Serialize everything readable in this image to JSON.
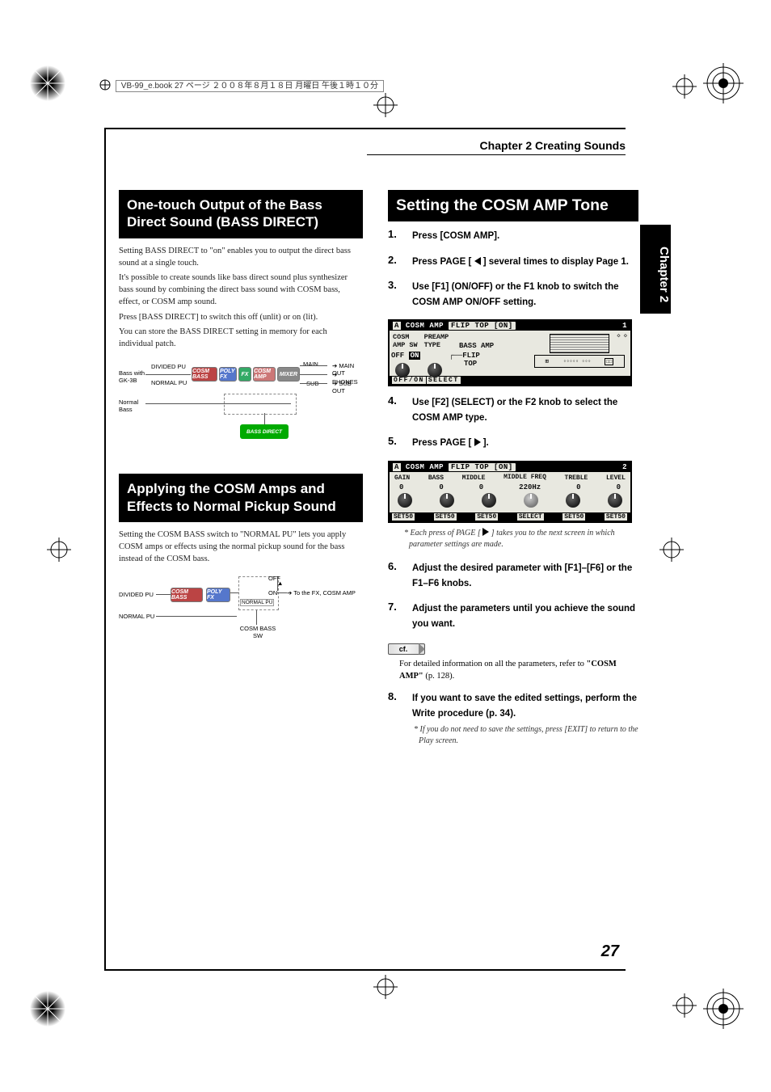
{
  "meta": {
    "header_info": "VB-99_e.book 27 ページ ２００８年８月１８日 月曜日 午後１時１０分"
  },
  "chapter_header": "Chapter 2 Creating Sounds",
  "side_tab": "Chapter 2",
  "page_number": "27",
  "left": {
    "section1": {
      "title": "One-touch Output of the Bass Direct Sound (BASS DIRECT)",
      "p1": "Setting BASS DIRECT to \"on\" enables you to output the direct bass sound at a single touch.",
      "p2": "It's possible to create sounds like bass direct sound plus synthesizer bass sound by combining the direct bass sound with COSM bass, effect, or COSM amp sound.",
      "p3": "Press [BASS DIRECT] to switch this off (unlit) or on (lit).",
      "p4": "You can store the BASS DIRECT setting in memory for each individual patch.",
      "diagram1": {
        "bass_with": "Bass with\nGK-3B",
        "normal_bass": "Normal\nBass",
        "divided_pu": "DIVIDED PU",
        "normal_pu": "NORMAL PU",
        "blk_cosm_bass": "COSM BASS",
        "blk_poly_fx": "POLY FX",
        "blk_fx": "FX",
        "blk_cosm_amp": "COSM AMP",
        "blk_mixer": "MIXER",
        "main": "MAIN",
        "sub": "SUB",
        "main_out": "MAIN OUT",
        "phones": "PHONES",
        "sub_out": "SUB OUT",
        "bass_direct": "BASS DIRECT"
      }
    },
    "section2": {
      "title": "Applying the COSM Amps and Effects to Normal Pickup Sound",
      "p1": "Setting the COSM BASS switch to \"NORMAL PU\" lets you apply COSM amps or effects using the normal pickup sound for the bass instead of the COSM bass.",
      "diagram2": {
        "divided_pu": "DIVIDED PU",
        "normal_pu": "NORMAL PU",
        "cosm_bass": "COSM BASS",
        "poly_fx": "POLY FX",
        "off": "OFF",
        "on": "ON",
        "normal_pu_opt": "NORMAL PU",
        "to_fx": "To the FX, COSM AMP",
        "sw_label": "COSM BASS\nSW"
      }
    }
  },
  "right": {
    "section": {
      "title": "Setting the COSM AMP Tone",
      "steps": [
        {
          "num": "1.",
          "text": "Press [COSM AMP]."
        },
        {
          "num": "2.",
          "text_pre": "Press PAGE [ ",
          "text_post": " ] several times to display Page 1.",
          "tri": "left"
        },
        {
          "num": "3.",
          "text": "Use [F1] (ON/OFF) or the F1 knob to switch the COSM AMP ON/OFF setting."
        },
        {
          "num": "4.",
          "text": "Use [F2] (SELECT) or the F2 knob to select the COSM AMP type."
        },
        {
          "num": "5.",
          "text_pre": "Press PAGE [ ",
          "text_post": " ].",
          "tri": "right",
          "note_pre": "Each press of PAGE [ ",
          "note_post": " ] takes you to the next screen in which parameter settings are made."
        },
        {
          "num": "6.",
          "text": "Adjust the desired parameter with [F1]–[F6] or the F1–F6 knobs."
        },
        {
          "num": "7.",
          "text": "Adjust the parameters until you achieve the sound you want."
        },
        {
          "num": "8.",
          "text": "If you want to save the edited settings, perform the Write procedure (p. 34).",
          "note": "If you do not need to save the settings, press [EXIT] to return to the Play screen."
        }
      ],
      "cf": {
        "label": "cf.",
        "text_a": "For detailed information on all the parameters, refer to ",
        "text_b": "\"COSM AMP\"",
        "text_c": " (p. 128)."
      },
      "lcd1": {
        "tab": "A",
        "title_a": "COSM AMP",
        "title_b": "FLIP TOP [ON]",
        "page": "1",
        "row1a": "COSM",
        "row1b": "PREAMP",
        "row2a": "AMP SW",
        "row2b": "TYPE",
        "bass_amp": "BASS AMP",
        "off": "OFF",
        "on": "ON",
        "flip": "FLIP",
        "top": "TOP",
        "bottom_a": "OFF/ON",
        "bottom_b": "SELECT"
      },
      "lcd2": {
        "tab": "A",
        "title_a": "COSM AMP",
        "title_b": "FLIP TOP [ON]",
        "page": "2",
        "labels": [
          "GAIN",
          "BASS",
          "MIDDLE",
          "MIDDLE FREQ",
          "TREBLE",
          "LEVEL"
        ],
        "vals": [
          "0",
          "0",
          "0",
          "220Hz",
          "0",
          "0"
        ],
        "bottom": [
          "SET50",
          "SET50",
          "SET50",
          "SELECT",
          "SET50",
          "SET50"
        ]
      }
    }
  }
}
